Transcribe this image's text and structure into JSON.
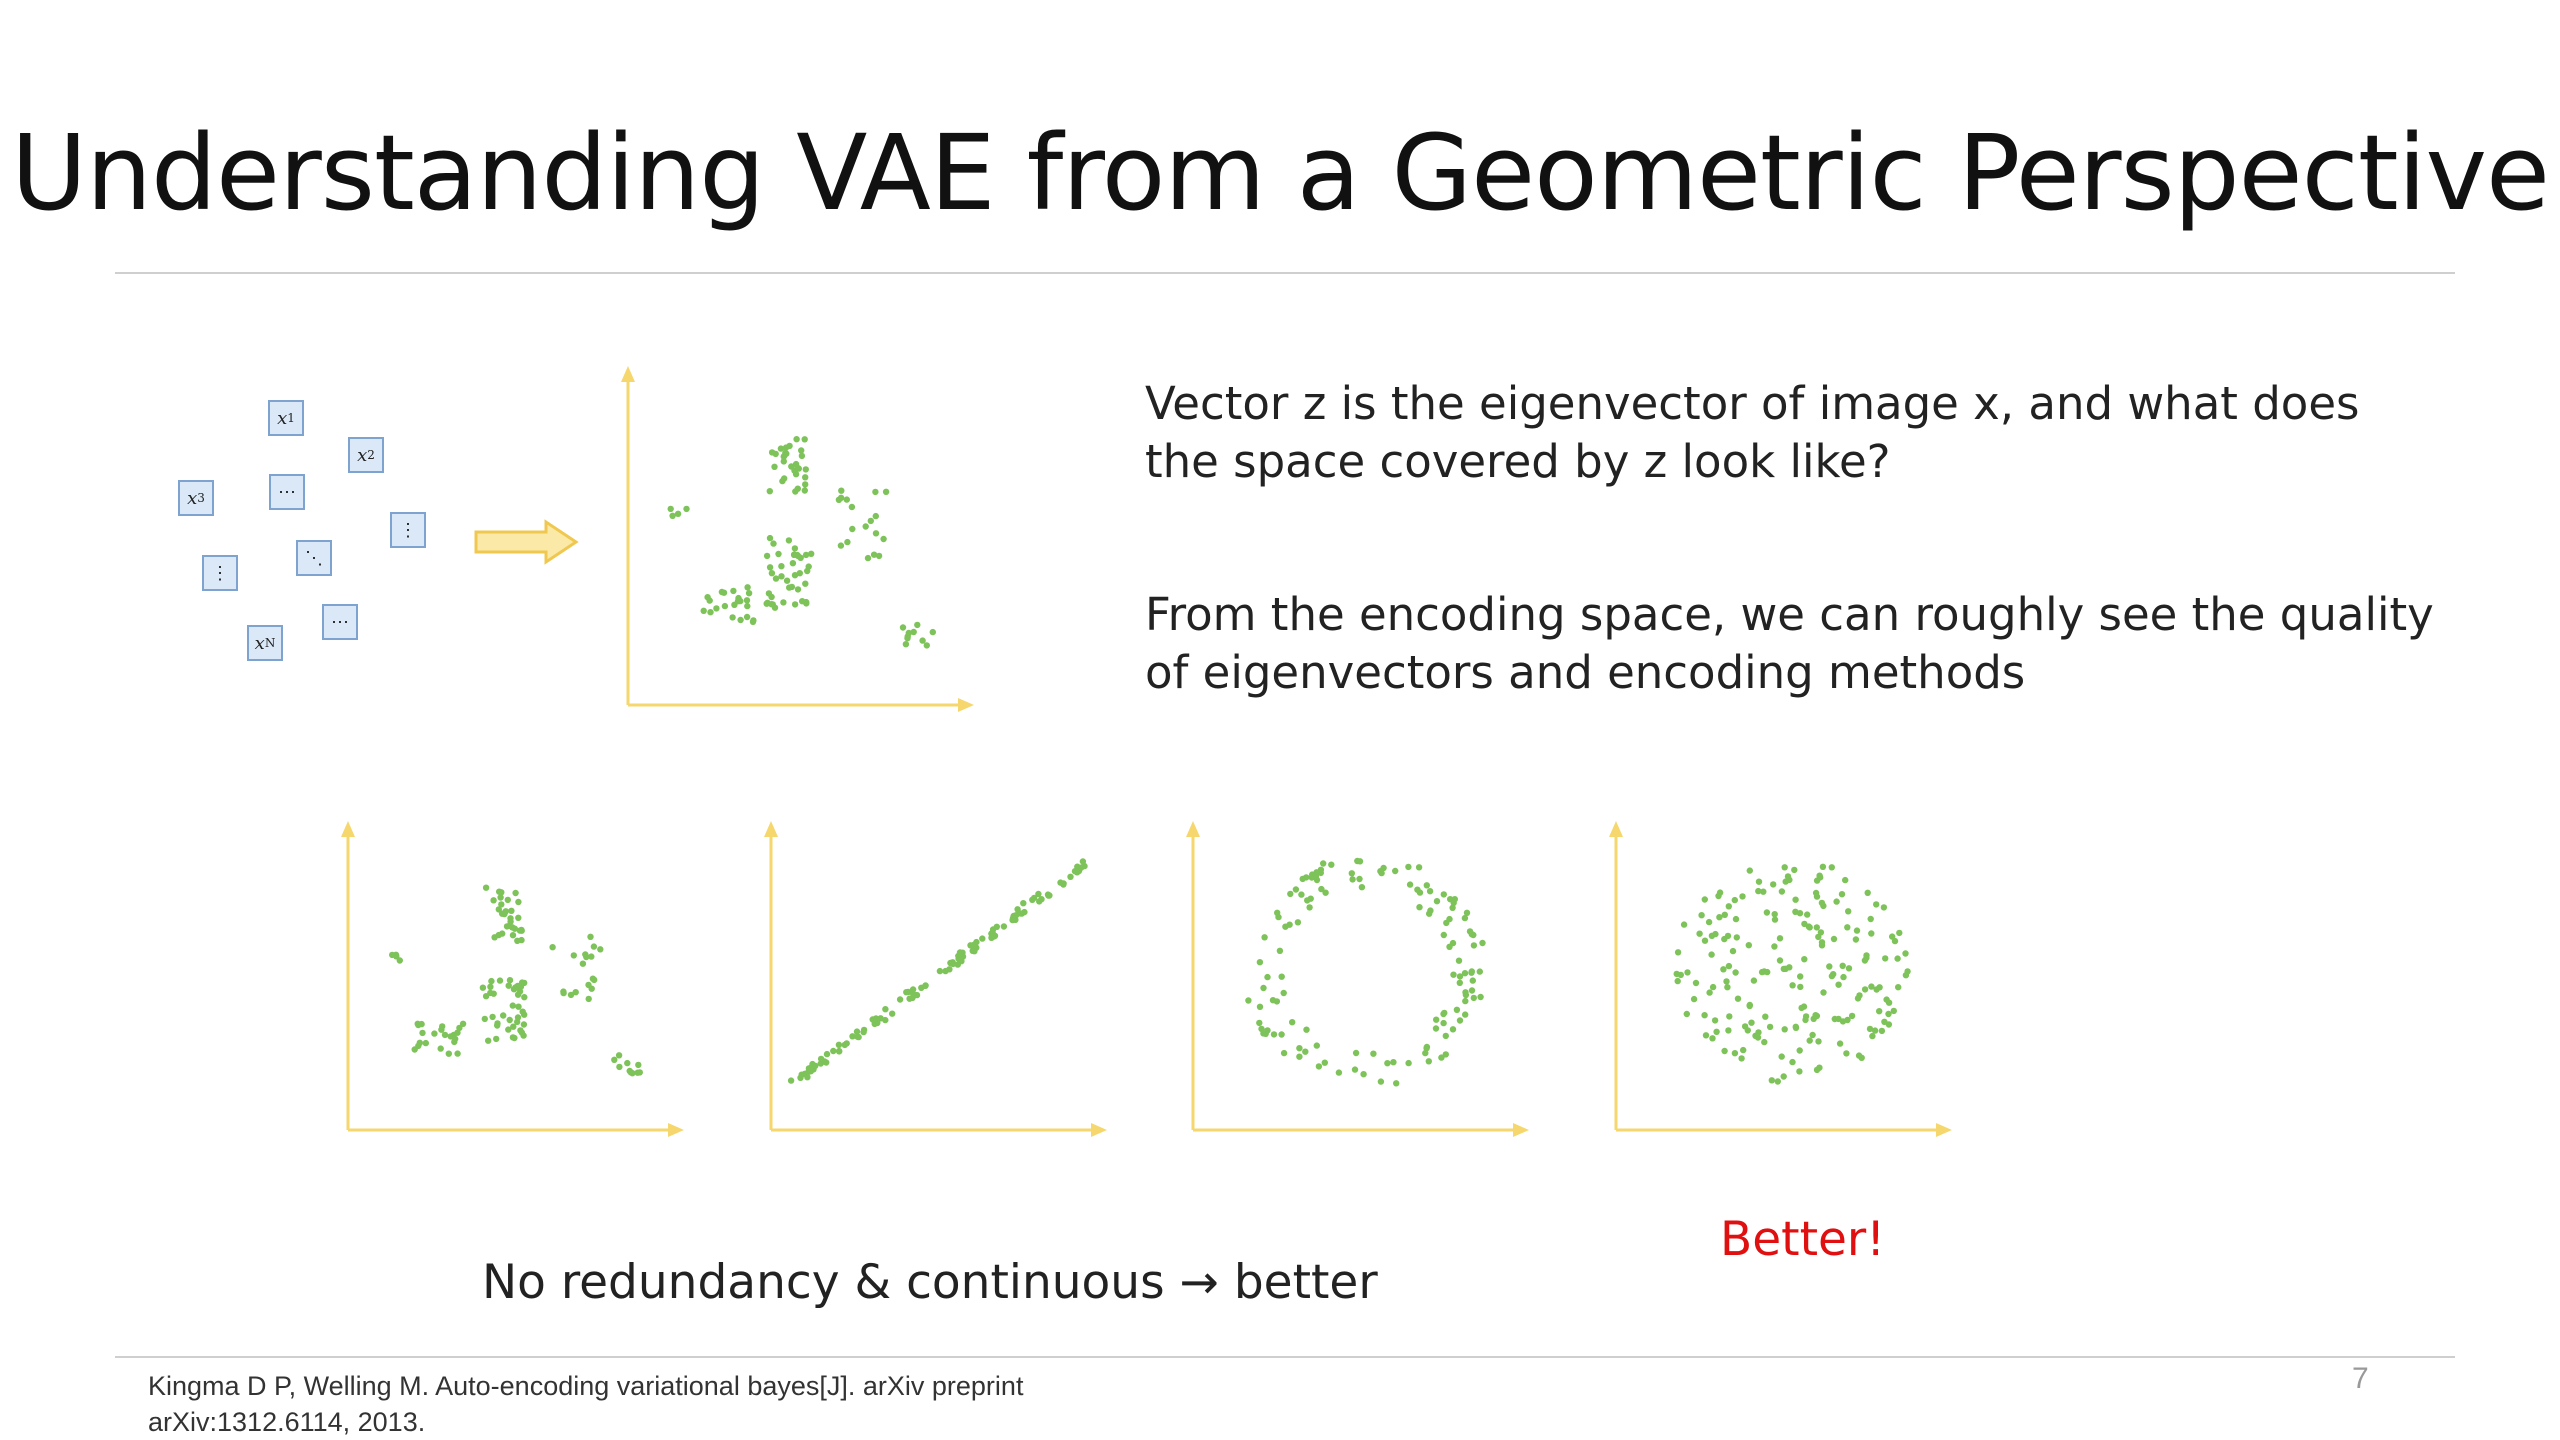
{
  "slide": {
    "title": "Understanding VAE from a Geometric Perspective",
    "paragraph1": "Vector z is the eigenvector of image x, and what does the space covered by z look like?",
    "paragraph2": "From  the encoding space, we can roughly see the quality of eigenvectors and encoding methods",
    "caption": "No redundancy & continuous → better",
    "better_label": "Better!",
    "reference_line1": "Kingma D P, Welling M. Auto-encoding variational bayes[J]. arXiv preprint",
    "reference_line2": "arXiv:1312.6114, 2013.",
    "page_number": "7"
  },
  "data_boxes": [
    {
      "var": "x",
      "sub": "1"
    },
    {
      "var": "x",
      "sub": "2"
    },
    {
      "var": "x",
      "sub": "3"
    },
    {
      "var": "⋯",
      "sub": ""
    },
    {
      "var": "⋮",
      "sub": ""
    },
    {
      "var": "⋮",
      "sub": ""
    },
    {
      "var": "⋱",
      "sub": ""
    },
    {
      "var": "⋯",
      "sub": ""
    },
    {
      "var": "x",
      "sub": "N"
    }
  ],
  "colors": {
    "axis": "#f5d76e",
    "points": "#7dc35a",
    "box_fill": "#dbe8f8",
    "box_border": "#7fa3cf",
    "arrow_fill": "#fbe9a8",
    "arrow_stroke": "#f0c850",
    "better": "#e01010",
    "rule": "#cfcfcf"
  },
  "plots": [
    {
      "id": "top",
      "pattern": "irregular"
    },
    {
      "id": "p1",
      "pattern": "irregular"
    },
    {
      "id": "p2",
      "pattern": "line"
    },
    {
      "id": "p3",
      "pattern": "ring"
    },
    {
      "id": "p4",
      "pattern": "disk"
    }
  ],
  "icons": {
    "arrow": "right-block-arrow"
  }
}
